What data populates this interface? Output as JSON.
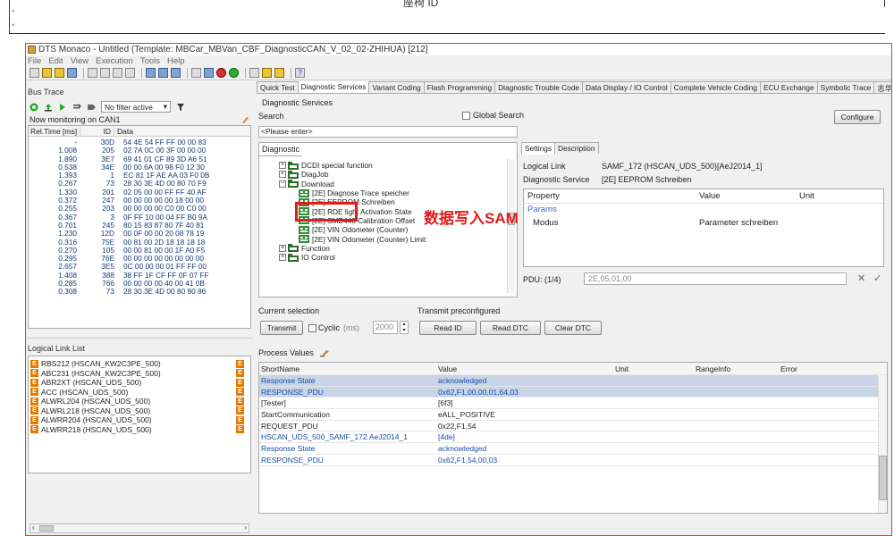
{
  "top_doc": {
    "title": "座椅 ID"
  },
  "window": {
    "title": "DTS Monaco - Untitled (Template: MBCar_MBVan_CBF_DiagnosticCAN_V_02_02-ZHIHUA) [212]"
  },
  "menu": [
    "File",
    "Edit",
    "View",
    "Execution",
    "Tools",
    "Help"
  ],
  "bus_trace": {
    "label": "Bus Trace",
    "filter": "No filter active",
    "monitoring": "Now monitoring on CAN1",
    "columns": [
      "Rel.Time [ms]",
      "ID",
      "Data"
    ],
    "rows": [
      [
        "-",
        "30D",
        "54 4E 54 FF FF 00 00 83"
      ],
      [
        "1.008",
        "205",
        "02 7A 0C 00 3F 00 00 00"
      ],
      [
        "1.890",
        "3E7",
        "69 41 01 CF 89 3D A6 51"
      ],
      [
        "0.538",
        "34E",
        "00 00 6A 00 98 F0 12 30"
      ],
      [
        "1.393",
        "1",
        "EC 81 1F AE AA 03 F0 0B"
      ],
      [
        "0.267",
        "73",
        "28 30 3E 4D 00 80 70 F9"
      ],
      [
        "1.330",
        "201",
        "02 05 00 00 FF FF 40 AF"
      ],
      [
        "0.372",
        "247",
        "00 00 00 00 00 18 00 00"
      ],
      [
        "0.255",
        "203",
        "00 00 00 00 C0 00 C0 00"
      ],
      [
        "0.367",
        "3",
        "0F FF 10 00 04 FF B0 9A"
      ],
      [
        "0.701",
        "245",
        "80 15 83 87 80 7F 40 81"
      ],
      [
        "1.230",
        "12D",
        "00 0F 00 00 20 08 78 19"
      ],
      [
        "0.316",
        "75E",
        "00 81 00 2D 18 18 18 18"
      ],
      [
        "0.270",
        "105",
        "00 00 81 00 00 1F A0 F5"
      ],
      [
        "0.295",
        "76E",
        "00 00 00 00 00 00 00 00"
      ],
      [
        "2.657",
        "3E5",
        "0C 00 00 00 01 FF FF 00"
      ],
      [
        "1.408",
        "388",
        "38 FF 1F CF FF 0F 07 FF"
      ],
      [
        "0.285",
        "766",
        "00 00 00 00 40 00 41 0B"
      ],
      [
        "0.308",
        "73",
        "28 30 3E 4D 00 80 80 86"
      ]
    ]
  },
  "logical_links": {
    "label": "Logical Link List",
    "items": [
      "RBS212 (HSCAN_KW2C3PE_500)",
      "ABC231 (HSCAN_KW2C3PE_500)",
      "ABR2XT (HSCAN_UDS_500)",
      "ACC (HSCAN_UDS_500)",
      "ALWRL204 (HSCAN_UDS_500)",
      "ALWRL218 (HSCAN_UDS_500)",
      "ALWRR204 (HSCAN_UDS_500)",
      "ALWRR218 (HSCAN_UDS_500)"
    ]
  },
  "main_tabs": [
    "Quick Test",
    "Diagnostic Services",
    "Variant Coding",
    "Flash Programming",
    "Diagnostic Trouble Code",
    "Data Display / IO Control",
    "Complete Vehicle Coding",
    "ECU Exchange",
    "Symbolic Trace",
    "志华汽车"
  ],
  "diag": {
    "section": "Diagnostic Services",
    "search_label": "Search",
    "global_search": "Global Search",
    "configure": "Configure",
    "search_placeholder": "<Please enter>",
    "tree_tab": "Diagnostic",
    "tree": [
      {
        "label": "DCDI special function",
        "level": 1
      },
      {
        "label": "DiagJob",
        "level": 1
      },
      {
        "label": "Download",
        "level": 1
      },
      {
        "label": "[2E] Diagnose Trace speicher",
        "level": 2
      },
      {
        "label": "[2E] EEPROM Schreiben",
        "level": 2
      },
      {
        "label": "[2E] RDE light Activation State",
        "level": 2
      },
      {
        "label": "[2E] SMB440 Calibration Offset",
        "level": 2
      },
      {
        "label": "[2E] VIN Odometer (Counter)",
        "level": 2
      },
      {
        "label": "[2E] VIN Odometer (Counter) Limit",
        "level": 2
      },
      {
        "label": "Function",
        "level": 1
      },
      {
        "label": "IO Control",
        "level": 1
      }
    ],
    "annotation": "数据写入SAM"
  },
  "settings": {
    "tabs": [
      "Settings",
      "Description"
    ],
    "logical_link_label": "Logical Link",
    "logical_link": "SAMF_172 (HSCAN_UDS_500)[AeJ2014_1]",
    "service_label": "Diagnostic Service",
    "service": "[2E] EEPROM Schreiben",
    "columns": [
      "Property",
      "Value",
      "Unit"
    ],
    "params_label": "Params",
    "modus_label": "Modus",
    "modus_value": "Parameter schreiben",
    "pdu_label": "PDU: (1/4)",
    "pdu_value": "2E,05,01,00"
  },
  "current_selection": {
    "label": "Current selection",
    "transmit": "Transmit",
    "cyclic": "Cyclic",
    "ms_label": "(ms)",
    "interval": "2000"
  },
  "preconfigured": {
    "label": "Transmit preconfigured",
    "buttons": [
      "Read ID",
      "Read DTC",
      "Clear DTC"
    ]
  },
  "process_values": {
    "label": "Process Values",
    "columns": [
      "ShortName",
      "Value",
      "Unit",
      "RangeInfo",
      "Error"
    ],
    "rows": [
      [
        "Response State",
        "acknowledged",
        "",
        "",
        ""
      ],
      [
        "RESPONSE_PDU",
        "0x62,F1,00,00,01,64,03",
        "",
        "",
        ""
      ],
      [
        "[Tester]",
        "[6f3]",
        "",
        "",
        ""
      ],
      [
        "StartCommunication",
        "eALL_POSITIVE",
        "",
        "",
        ""
      ],
      [
        "REQUEST_PDU",
        "0x22,F1,54",
        "",
        "",
        ""
      ],
      [
        "HSCAN_UDS_500_SAMF_172.AeJ2014_1",
        "[4de]",
        "",
        "",
        ""
      ],
      [
        "Response State",
        "acknowledged",
        "",
        "",
        ""
      ],
      [
        "RESPONSE_PDU",
        "0x62,F1,54,00,03",
        "",
        "",
        ""
      ]
    ]
  }
}
